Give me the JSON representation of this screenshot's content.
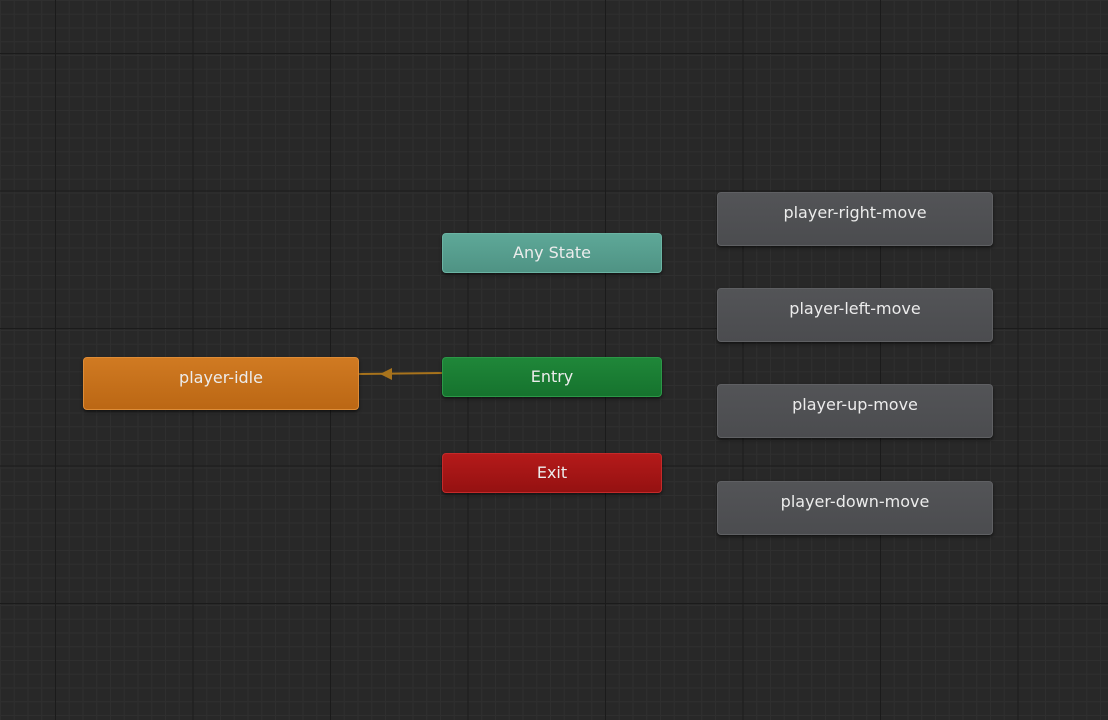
{
  "colors": {
    "background": "#282828",
    "default_state": "#4f5053",
    "default_state_node": "#de8c36",
    "any_state": "#5ea898",
    "entry": "#1f8739",
    "exit": "#b41a1a",
    "transition": "#a8731c"
  },
  "nodes": {
    "player_idle": {
      "label": "player-idle",
      "type": "default-state"
    },
    "any_state": {
      "label": "Any State",
      "type": "any-state"
    },
    "entry": {
      "label": "Entry",
      "type": "entry"
    },
    "exit": {
      "label": "Exit",
      "type": "exit"
    },
    "states": [
      {
        "label": "player-right-move"
      },
      {
        "label": "player-left-move"
      },
      {
        "label": "player-up-move"
      },
      {
        "label": "player-down-move"
      }
    ]
  },
  "transitions": [
    {
      "from": "Entry",
      "to": "player-idle"
    }
  ]
}
